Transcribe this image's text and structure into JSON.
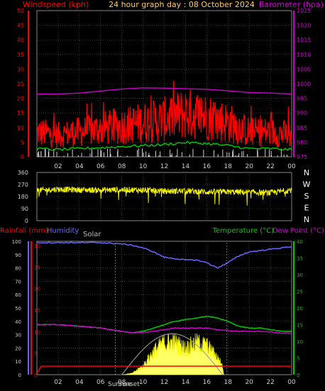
{
  "top_panel": {
    "title": "24 hour graph day : 08 October 2024",
    "left_label": "Windspeed (kph)",
    "right_label": "Barometer (hpa)",
    "left_ticks": [
      "0",
      "5",
      "10",
      "15",
      "20",
      "25",
      "30",
      "35",
      "40",
      "45",
      "50"
    ],
    "right_ticks": [
      "975",
      "980",
      "985",
      "990",
      "995",
      "1000",
      "1005",
      "1010",
      "1015",
      "1020",
      "1025"
    ]
  },
  "direction_panel": {
    "left_ticks": [
      "0",
      "90",
      "180",
      "270",
      "360"
    ],
    "compass": [
      "N",
      "W",
      "S",
      "E",
      "N"
    ]
  },
  "bottom_panel": {
    "rain_label": "Rainfall (mm)",
    "humidity_label": "Humidity",
    "solar_label": "Solar",
    "temp_label": "Temperature (°C)",
    "dew_label": "Dew Point (°C)",
    "humidity_ticks": [
      "0",
      "10",
      "20",
      "30",
      "40",
      "50",
      "60",
      "70",
      "80",
      "90",
      "100"
    ],
    "rain_ticks": [
      "0",
      "5",
      "10",
      "15",
      "20",
      "25",
      "30"
    ],
    "temp_ticks": [
      "0",
      "5",
      "10",
      "15",
      "20",
      "25",
      "30",
      "35",
      "40"
    ],
    "sunrise_label": "Sunrise",
    "sunset_label": "Sunset"
  },
  "x_ticks": [
    "02",
    "04",
    "06",
    "08",
    "10",
    "12",
    "14",
    "16",
    "18",
    "20",
    "22",
    "00"
  ],
  "colors": {
    "wind": "#ff0000",
    "barometer": "#cc00cc",
    "direction": "#ffff00",
    "humidity": "#6666ff",
    "rain": "#ff0000",
    "temperature": "#00cc00",
    "dewpoint": "#cc00cc",
    "solar": "#ffff66",
    "grid": "#555555",
    "label_orange": "#ffcc66",
    "solar_label": "#b8b8b8"
  },
  "chart_data": [
    {
      "type": "line",
      "title": "24 hour graph day : 08 October 2024",
      "xlabel": "",
      "ylabel": "Windspeed (kph)",
      "y2label": "Barometer (hpa)",
      "x": [
        0,
        2,
        4,
        6,
        8,
        10,
        12,
        14,
        16,
        18,
        20,
        22,
        24
      ],
      "ylim": [
        0,
        50
      ],
      "y2lim": [
        975,
        1025
      ],
      "series": [
        {
          "name": "Windspeed (kph)",
          "axis": "left",
          "values": [
            8,
            7,
            8,
            9,
            10,
            11,
            12,
            14,
            13,
            11,
            8,
            8,
            7
          ]
        },
        {
          "name": "Barometer (hpa)",
          "axis": "right",
          "values": [
            996.5,
            996.5,
            996.8,
            997.5,
            998.2,
            998.6,
            998.5,
            998.3,
            998.1,
            997.6,
            997.0,
            996.8,
            996.5
          ]
        }
      ]
    },
    {
      "type": "scatter",
      "title": "",
      "ylabel": "",
      "x": [
        0,
        2,
        4,
        6,
        8,
        10,
        12,
        14,
        16,
        18,
        20,
        22,
        24
      ],
      "ylim": [
        0,
        360
      ],
      "series": [
        {
          "name": "",
          "values": [
            225,
            235,
            230,
            228,
            232,
            228,
            220,
            222,
            215,
            215,
            212,
            208,
            230
          ]
        }
      ]
    },
    {
      "type": "line",
      "title": "",
      "ylabel": "Humidity",
      "ylim": [
        0,
        100
      ],
      "y2lim": [
        0,
        40
      ],
      "y3lim": [
        0,
        30
      ],
      "x": [
        0,
        2,
        4,
        6,
        8,
        9,
        10,
        11,
        12,
        13,
        14,
        15,
        16,
        17,
        18,
        19,
        20,
        21,
        22,
        23,
        24
      ],
      "series": [
        {
          "name": "Humidity",
          "axis": "left",
          "values": [
            99,
            99,
            99,
            99,
            98,
            97,
            95,
            92,
            88,
            87,
            86,
            86,
            84,
            80,
            84,
            89,
            92,
            93,
            94,
            95,
            96
          ]
        },
        {
          "name": "Temperature (°C)",
          "axis": "temp",
          "values": [
            15,
            15,
            14.5,
            14,
            13,
            12.5,
            13,
            14,
            15,
            16,
            16.5,
            17,
            17.5,
            17,
            16,
            14.5,
            14,
            14,
            13.5,
            13,
            13
          ]
        },
        {
          "name": "Dew Point (°C)",
          "axis": "temp",
          "values": [
            15,
            15,
            14.5,
            14,
            13,
            12.5,
            12.7,
            13,
            13.5,
            14,
            14,
            14,
            14,
            13.5,
            13.2,
            13,
            13,
            13,
            12.8,
            12.5,
            12.5
          ]
        },
        {
          "name": "Rainfall (mm)",
          "axis": "rain",
          "values": [
            0,
            0.3,
            0.3,
            0.3,
            0.3,
            0.3,
            0.3,
            0.3,
            0.3,
            0.3,
            0.3,
            0.3,
            0.3,
            0.3,
            0.3,
            0.3,
            0.3,
            0.3,
            0.3,
            0.3,
            0.3
          ]
        },
        {
          "name": "Solar",
          "axis": "temp",
          "values": [
            0,
            0,
            0,
            0,
            0,
            0.5,
            3,
            8,
            11,
            11,
            9,
            11,
            10,
            6,
            0,
            0,
            0,
            0,
            0,
            0,
            0
          ]
        }
      ]
    }
  ]
}
